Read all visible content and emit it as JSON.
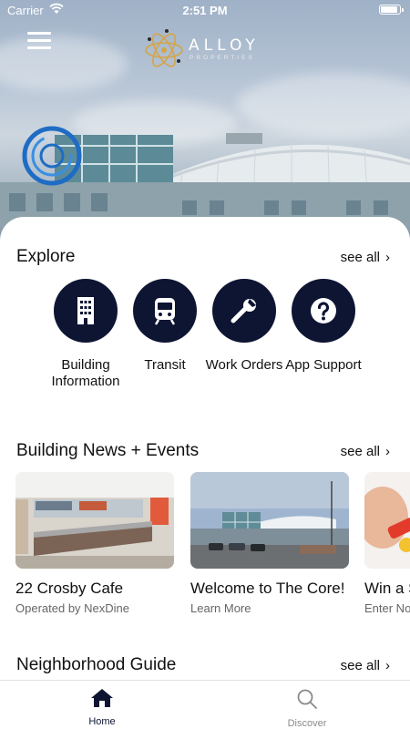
{
  "status_bar": {
    "carrier": "Carrier",
    "time": "2:51 PM",
    "battery_level": 0.9
  },
  "header": {
    "logo_text": "ALLOY",
    "logo_subtext": "PROPERTIES",
    "menu_icon": "hamburger-menu-icon"
  },
  "explore": {
    "title": "Explore",
    "see_all": "see all",
    "items": [
      {
        "label": "Building Information",
        "icon": "building-icon"
      },
      {
        "label": "Transit",
        "icon": "train-icon"
      },
      {
        "label": "Work Orders",
        "icon": "wrench-icon"
      },
      {
        "label": "App Support",
        "icon": "question-icon"
      }
    ]
  },
  "news": {
    "title": "Building News + Events",
    "see_all": "see all",
    "cards": [
      {
        "title": "22 Crosby Cafe",
        "subtitle": "Operated by NexDine"
      },
      {
        "title": "Welcome to The Core!",
        "subtitle": "Learn More"
      },
      {
        "title": "Win a S",
        "subtitle": "Enter No"
      }
    ]
  },
  "neighborhood": {
    "title": "Neighborhood Guide",
    "see_all": "see all"
  },
  "tabbar": {
    "tabs": [
      {
        "label": "Home",
        "icon": "home-icon",
        "active": true
      },
      {
        "label": "Discover",
        "icon": "search-icon",
        "active": false
      }
    ]
  },
  "colors": {
    "accent": "#0e1533",
    "logo_gold": "#d4a547",
    "inactive_tab": "#8a8a8a"
  }
}
